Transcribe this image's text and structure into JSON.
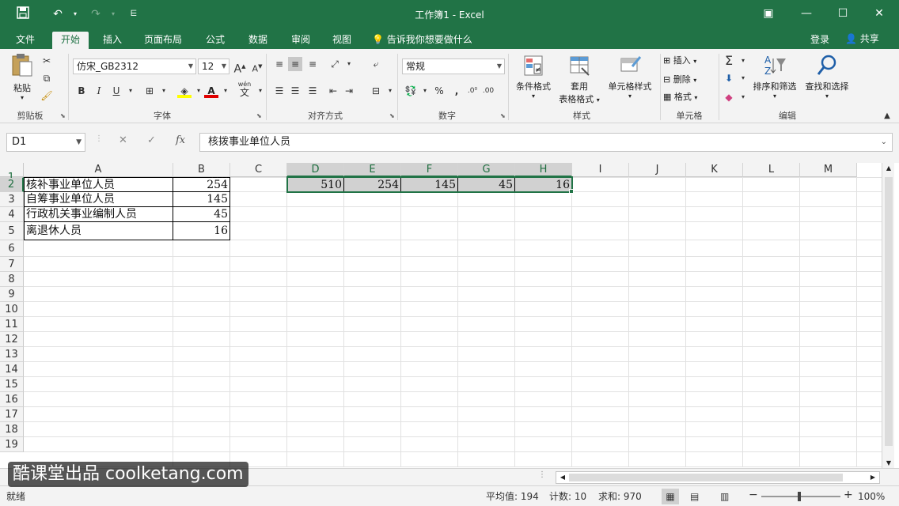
{
  "titlebar": {
    "title": "工作簿1 - Excel",
    "save_icon": "save-icon",
    "undo_icon": "undo-icon",
    "redo_icon": "redo-icon"
  },
  "tabs": {
    "file": "文件",
    "home": "开始",
    "insert": "插入",
    "page_layout": "页面布局",
    "formulas": "公式",
    "data": "数据",
    "review": "审阅",
    "view": "视图",
    "tell_me": "告诉我你想要做什么",
    "login": "登录",
    "share": "共享"
  },
  "ribbon": {
    "clipboard": {
      "label": "剪贴板",
      "paste": "粘贴"
    },
    "font": {
      "label": "字体",
      "font_name": "仿宋_GB2312",
      "font_size": "12",
      "bold": "B",
      "italic": "I",
      "underline": "U",
      "wen": "wén",
      "wen2": "文",
      "grow": "A",
      "shrink": "A"
    },
    "alignment": {
      "label": "对齐方式"
    },
    "number": {
      "label": "数字",
      "format": "常规",
      "percent": "%",
      "comma": ","
    },
    "styles": {
      "label": "样式",
      "conditional": "条件格式",
      "table_format_1": "套用",
      "table_format_2": "表格格式",
      "cell_styles": "单元格样式"
    },
    "cells": {
      "label": "单元格",
      "insert": "插入",
      "delete": "删除",
      "format": "格式"
    },
    "editing": {
      "label": "编辑",
      "sort_filter": "排序和筛选",
      "find_select": "查找和选择",
      "sigma": "Σ"
    }
  },
  "formula_bar": {
    "name_box": "D1",
    "fx": "fx",
    "content": "核拨事业单位人员"
  },
  "columns": [
    "A",
    "B",
    "C",
    "D",
    "E",
    "F",
    "G",
    "H",
    "I",
    "J",
    "K",
    "L",
    "M"
  ],
  "rows": [
    "1",
    "2",
    "3",
    "4",
    "5",
    "6",
    "7",
    "8",
    "9",
    "10",
    "11",
    "12",
    "13",
    "14",
    "15",
    "16",
    "17",
    "18",
    "19"
  ],
  "table_source": [
    {
      "label": "核拨事业单位人员",
      "value": "510"
    },
    {
      "label": "核补事业单位人员",
      "value": "254"
    },
    {
      "label": "自筹事业单位人员",
      "value": "145"
    },
    {
      "label": "行政机关事业编制人员",
      "value": "45"
    },
    {
      "label": "离退休人员",
      "value": "16"
    }
  ],
  "transposed": {
    "headers": [
      "核拨事业单位人员",
      "核补事业单位人员",
      "自筹事业单位人员",
      "行政机关事业编制人员",
      "离退休人员"
    ],
    "values": [
      "510",
      "254",
      "145",
      "45",
      "16"
    ]
  },
  "status": {
    "ready": "就绪",
    "average": "平均值: 194",
    "count": "计数: 10",
    "sum": "求和: 970",
    "zoom": "100%"
  },
  "overlay": {
    "watermark": "酷课堂出品 coolketang.com",
    "step": "12"
  },
  "colors": {
    "excel_green": "#217346",
    "ribbon_bg": "#f3f3f3"
  }
}
